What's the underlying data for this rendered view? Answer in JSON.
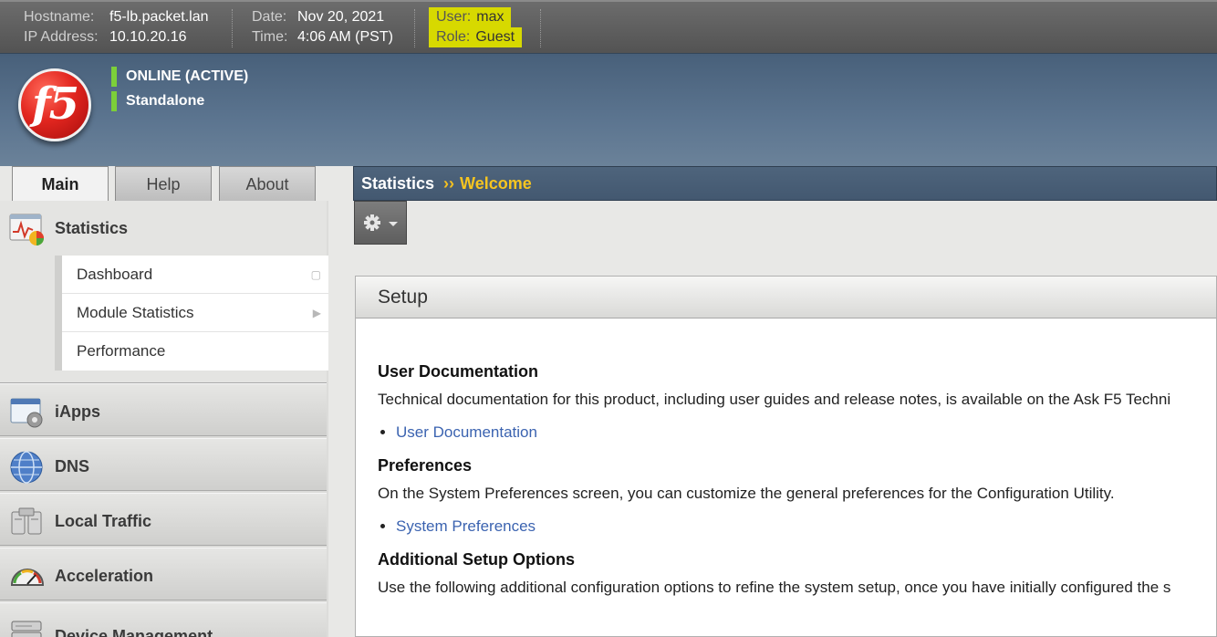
{
  "topbar": {
    "hostname_label": "Hostname:",
    "hostname": "f5-lb.packet.lan",
    "ip_label": "IP Address:",
    "ip": "10.10.20.16",
    "date_label": "Date:",
    "date": "Nov 20, 2021",
    "time_label": "Time:",
    "time": "4:06 AM (PST)",
    "user_label": "User:",
    "user": "max",
    "role_label": "Role:",
    "role": "Guest",
    "highlight_color": "#d7d900"
  },
  "header": {
    "logo_text": "f5",
    "status_online": "ONLINE (ACTIVE)",
    "status_mode": "Standalone",
    "status_color": "#7ccf39"
  },
  "tabs": [
    {
      "label": "Main",
      "active": true
    },
    {
      "label": "Help",
      "active": false
    },
    {
      "label": "About",
      "active": false
    }
  ],
  "breadcrumb": {
    "root": "Statistics",
    "separator": "››",
    "current": "Welcome"
  },
  "sidebar": {
    "sections": [
      {
        "label": "Statistics",
        "icon": "statistics-chart-icon"
      },
      {
        "label": "iApps",
        "icon": "iapps-window-gear-icon"
      },
      {
        "label": "DNS",
        "icon": "globe-icon"
      },
      {
        "label": "Local Traffic",
        "icon": "server-pair-icon"
      },
      {
        "label": "Acceleration",
        "icon": "speedometer-icon"
      },
      {
        "label": "Device Management",
        "icon": "device-icon"
      }
    ],
    "stats_submenu": [
      {
        "label": "Dashboard",
        "marker": "popout-icon"
      },
      {
        "label": "Module Statistics",
        "marker": "chevron-right-icon"
      },
      {
        "label": "Performance",
        "marker": ""
      }
    ]
  },
  "toolbar": {
    "gear_icon": "gear-icon"
  },
  "panel": {
    "title": "Setup",
    "sections": [
      {
        "heading": "User Documentation",
        "text": "Technical documentation for this product, including user guides and release notes, is available on the Ask F5 Techni",
        "link": "User Documentation"
      },
      {
        "heading": "Preferences",
        "text": "On the System Preferences screen, you can customize the general preferences for the Configuration Utility.",
        "link": "System Preferences"
      },
      {
        "heading": "Additional Setup Options",
        "text": "Use the following additional configuration options to refine the system setup, once you have initially configured the s"
      }
    ]
  },
  "colors": {
    "header_blue": "#5c7590",
    "breadcrumb_current": "#f6c520",
    "link": "#3b63b0"
  }
}
